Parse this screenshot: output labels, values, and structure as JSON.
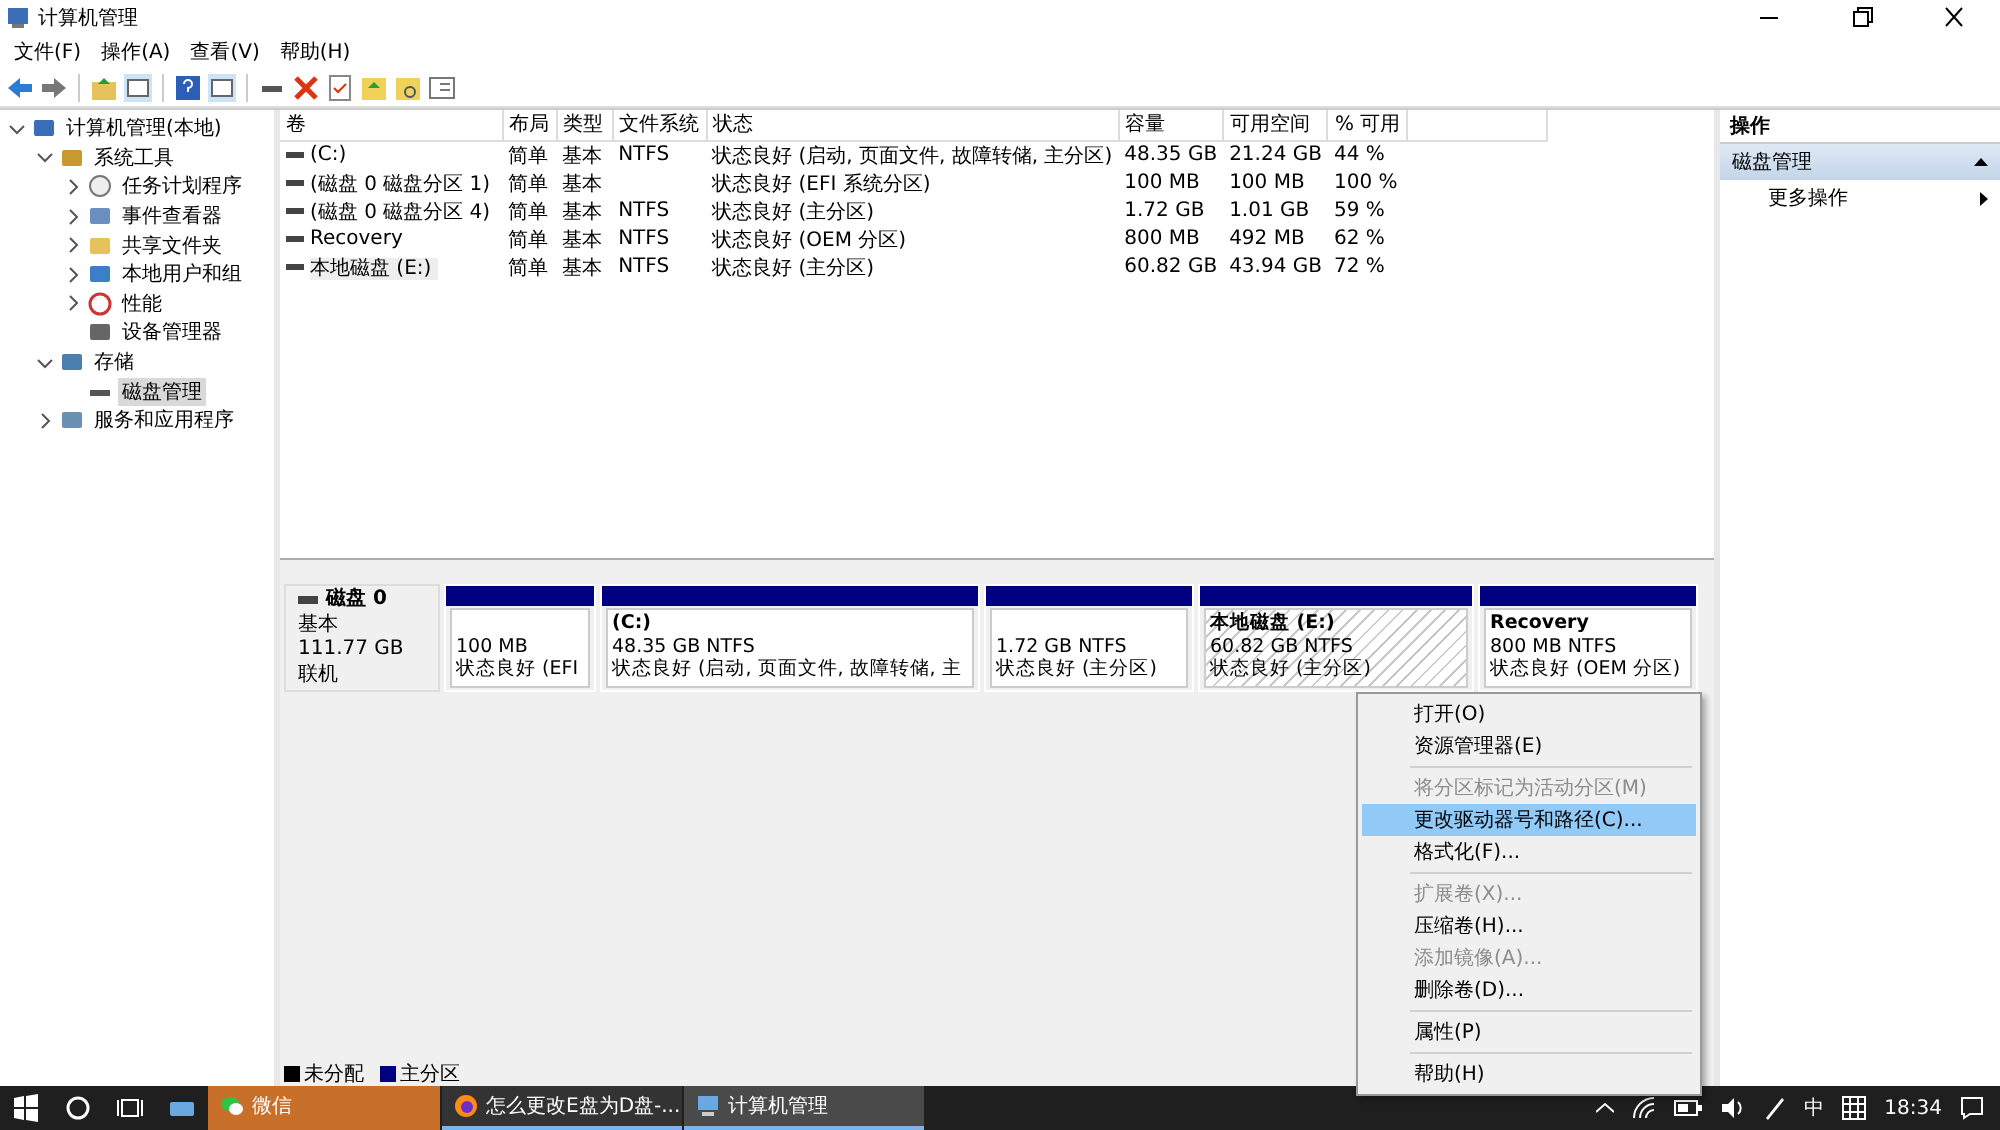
{
  "window": {
    "title": "计算机管理"
  },
  "menu": [
    "文件(F)",
    "操作(A)",
    "查看(V)",
    "帮助(H)"
  ],
  "tree": [
    {
      "label": "计算机管理(本地)",
      "expanded": true,
      "selected": false,
      "children": [
        {
          "label": "系统工具",
          "expanded": true,
          "selected": false,
          "children": [
            {
              "label": "任务计划程序",
              "expanded": false,
              "selected": false
            },
            {
              "label": "事件查看器",
              "expanded": false,
              "selected": false
            },
            {
              "label": "共享文件夹",
              "expanded": false,
              "selected": false
            },
            {
              "label": "本地用户和组",
              "expanded": false,
              "selected": false
            },
            {
              "label": "性能",
              "expanded": false,
              "selected": false
            },
            {
              "label": "设备管理器",
              "selected": false
            }
          ]
        },
        {
          "label": "存储",
          "expanded": true,
          "selected": false,
          "children": [
            {
              "label": "磁盘管理",
              "selected": true
            }
          ]
        },
        {
          "label": "服务和应用程序",
          "expanded": false,
          "selected": false
        }
      ]
    }
  ],
  "volumes": {
    "columns": [
      "卷",
      "布局",
      "类型",
      "文件系统",
      "状态",
      "容量",
      "可用空间",
      "% 可用"
    ],
    "rows": [
      {
        "selected": false,
        "cells": [
          "(C:)",
          "简单",
          "基本",
          "NTFS",
          "状态良好 (启动, 页面文件, 故障转储, 主分区)",
          "48.35 GB",
          "21.24 GB",
          "44 %"
        ]
      },
      {
        "selected": false,
        "cells": [
          "(磁盘 0 磁盘分区 1)",
          "简单",
          "基本",
          "",
          "状态良好 (EFI 系统分区)",
          "100 MB",
          "100 MB",
          "100 %"
        ]
      },
      {
        "selected": false,
        "cells": [
          "(磁盘 0 磁盘分区 4)",
          "简单",
          "基本",
          "NTFS",
          "状态良好 (主分区)",
          "1.72 GB",
          "1.01 GB",
          "59 %"
        ]
      },
      {
        "selected": false,
        "cells": [
          "Recovery",
          "简单",
          "基本",
          "NTFS",
          "状态良好 (OEM 分区)",
          "800 MB",
          "492 MB",
          "62 %"
        ]
      },
      {
        "selected": true,
        "cells": [
          "本地磁盘 (E:)",
          "简单",
          "基本",
          "NTFS",
          "状态良好 (主分区)",
          "60.82 GB",
          "43.94 GB",
          "72 %"
        ]
      }
    ]
  },
  "disk": {
    "name": "磁盘 0",
    "type": "基本",
    "size": "111.77 GB",
    "status": "联机",
    "partitions": [
      {
        "size": "100 MB",
        "status": "状态良好 (EFI",
        "selected": false
      },
      {
        "title": "(C:)",
        "size": "48.35 GB NTFS",
        "status": "状态良好 (启动, 页面文件, 故障转储, 主",
        "selected": false
      },
      {
        "size": "1.72 GB NTFS",
        "status": "状态良好 (主分区)",
        "selected": false
      },
      {
        "title": "本地磁盘  (E:)",
        "size": "60.82 GB NTFS",
        "status": "状态良好 (主分区)",
        "selected": true
      },
      {
        "title": "Recovery",
        "size": "800 MB NTFS",
        "status": "状态良好 (OEM 分区)",
        "selected": false
      }
    ]
  },
  "legend": [
    {
      "label": "未分配",
      "color": "#000000"
    },
    {
      "label": "主分区",
      "color": "#000080"
    }
  ],
  "actions": {
    "title": "操作",
    "section": "磁盘管理",
    "items": [
      "更多操作"
    ]
  },
  "context_menu": [
    [
      {
        "label": "打开(O)",
        "disabled": false,
        "selected": false
      },
      {
        "label": "资源管理器(E)",
        "disabled": false,
        "selected": false
      }
    ],
    [
      {
        "label": "将分区标记为活动分区(M)",
        "disabled": true,
        "selected": false
      },
      {
        "label": "更改驱动器号和路径(C)...",
        "disabled": false,
        "selected": true
      },
      {
        "label": "格式化(F)...",
        "disabled": false,
        "selected": false
      }
    ],
    [
      {
        "label": "扩展卷(X)...",
        "disabled": true,
        "selected": false
      },
      {
        "label": "压缩卷(H)...",
        "disabled": false,
        "selected": false
      },
      {
        "label": "添加镜像(A)...",
        "disabled": true,
        "selected": false
      },
      {
        "label": "删除卷(D)...",
        "disabled": false,
        "selected": false
      }
    ],
    [
      {
        "label": "属性(P)",
        "disabled": false,
        "selected": false
      }
    ],
    [
      {
        "label": "帮助(H)",
        "disabled": false,
        "selected": false
      }
    ]
  ],
  "taskbar": {
    "tasks": [
      {
        "label": "微信",
        "selected": false,
        "highlight": true
      },
      {
        "label": "怎么更改E盘为D盘-...",
        "selected": false,
        "highlight": false
      },
      {
        "label": "计算机管理",
        "selected": true,
        "highlight": false
      }
    ],
    "ime": "中",
    "time": "18:34"
  }
}
